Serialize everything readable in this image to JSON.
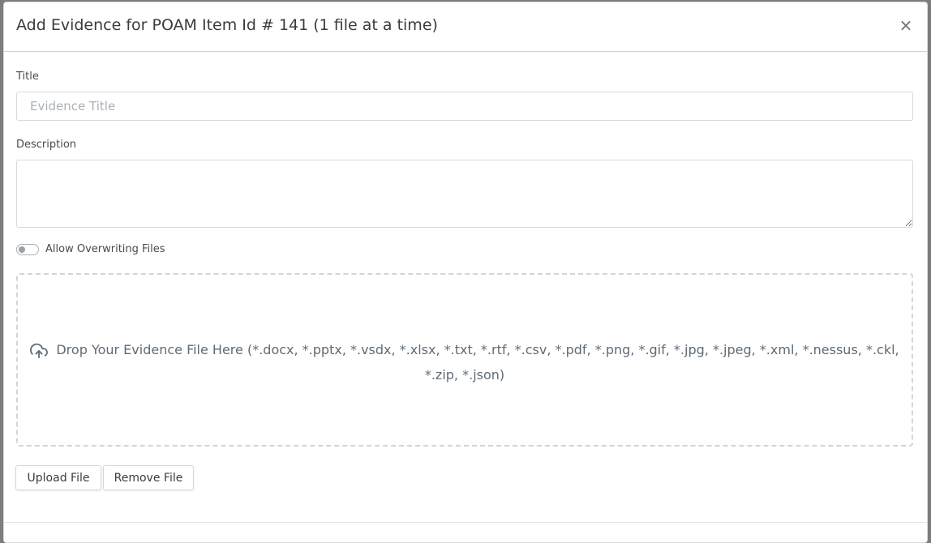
{
  "modal": {
    "title": "Add Evidence for POAM Item Id # 141 (1 file at a time)",
    "close_label": "×"
  },
  "form": {
    "title_label": "Title",
    "title_placeholder": "Evidence Title",
    "title_value": "",
    "description_label": "Description",
    "description_value": "",
    "overwrite_label": "Allow Overwriting Files",
    "overwrite_enabled": false
  },
  "dropzone": {
    "icon": "upload-cloud-icon",
    "text": "Drop Your Evidence File Here (*.docx, *.pptx, *.vsdx, *.xlsx, *.txt, *.rtf, *.csv, *.pdf, *.png, *.gif, *.jpg, *.jpeg, *.xml, *.nessus, *.ckl, *.zip, *.json)"
  },
  "buttons": {
    "upload_label": "Upload File",
    "remove_label": "Remove File"
  }
}
